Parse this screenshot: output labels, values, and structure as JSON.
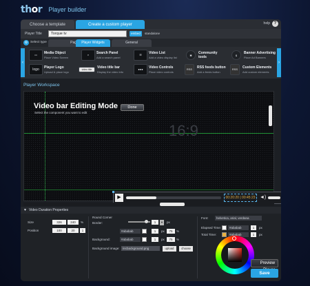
{
  "app": {
    "logo": "thor",
    "title": "Player builder"
  },
  "tabs": {
    "template": "Choose a template",
    "custom": "Create a custom player",
    "help": "help",
    "help_icon": "?"
  },
  "player_title": {
    "label": "Player Title",
    "value": "Torque tv",
    "embed": "embed",
    "standalone": "standalone"
  },
  "type_row": {
    "label": "Select type",
    "tabs": [
      "Page",
      "Player Widgets",
      "General"
    ]
  },
  "widgets": [
    {
      "name": "Media Object",
      "desc": "Place Video Screen",
      "icon": "media-object-icon"
    },
    {
      "name": "Search Panel",
      "desc": "Add a search panel",
      "icon": "search-panel-icon"
    },
    {
      "name": "Video List",
      "desc": "Add a video display list",
      "icon": "video-list-icon"
    },
    {
      "name": "Community tools",
      "desc": "",
      "icon": "community-tools-icon"
    },
    {
      "name": "Banner Advertising",
      "desc": "Place Ad Banners",
      "icon": "banner-advertising-icon"
    },
    {
      "name": "Player Logo",
      "desc": "Upload & place logo",
      "icon": "player-logo-icon",
      "icon_text": "logo"
    },
    {
      "name": "Video title bar",
      "desc": "Display the video info",
      "icon": "video-title-bar-icon",
      "icon_text": "video title"
    },
    {
      "name": "Video Controls",
      "desc": "Place video controls",
      "icon": "video-controls-icon"
    },
    {
      "name": "RSS feeds button",
      "desc": "Add a feeds button",
      "icon": "rss-icon",
      "icon_text": "RSS"
    },
    {
      "name": "Custom Elements",
      "desc": "Add custom elements",
      "icon": "custom-elements-icon",
      "icon_text": "RSS"
    }
  ],
  "workspace": {
    "title": "Player Workspace",
    "edit_title": "Video bar Editing Mode",
    "edit_subtitle": "Select the component you want to edit",
    "done": "Done",
    "aspect": "16:9",
    "videobar": {
      "time_current": "00:20:20",
      "time_total": "00:45:23",
      "progress": 0.32
    }
  },
  "properties": {
    "header": "Video Duration Properties",
    "size_label": "Size",
    "size_w": "326",
    "size_h": "240",
    "size_unit": "%",
    "position_label": "Position",
    "pos_x": "100",
    "pos_y": "20",
    "pos_unit": "1",
    "round_corner_label": "Round Corner",
    "border_label": "Border:",
    "border_value": "1",
    "px": "px",
    "border_color": "#ababab",
    "border_color_value": "1",
    "border_alpha": "75",
    "percent": "%",
    "background_label": "Background:",
    "bg_color": "#ababab",
    "bg_value": "1",
    "bg_alpha": "75",
    "bg_image_label": "Background image:",
    "bg_image_value": "/ecbackground.png",
    "upload": "upload",
    "choose": "choose",
    "font_label": "Font:",
    "font_value": "helvetica, arial, verdana",
    "elapsed_label": "Elapsed Time:",
    "elapsed_color": "#ababab",
    "elapsed_value": "1",
    "total_label": "Total Time:",
    "total_color": "#ababab",
    "total_value": "1"
  },
  "colors": {
    "accent": "#2aa5e3",
    "elapsed_chip": "#ffffff",
    "total_chip": "#e8b040"
  },
  "actions": {
    "preview": "Preview Player",
    "save": "Save"
  }
}
